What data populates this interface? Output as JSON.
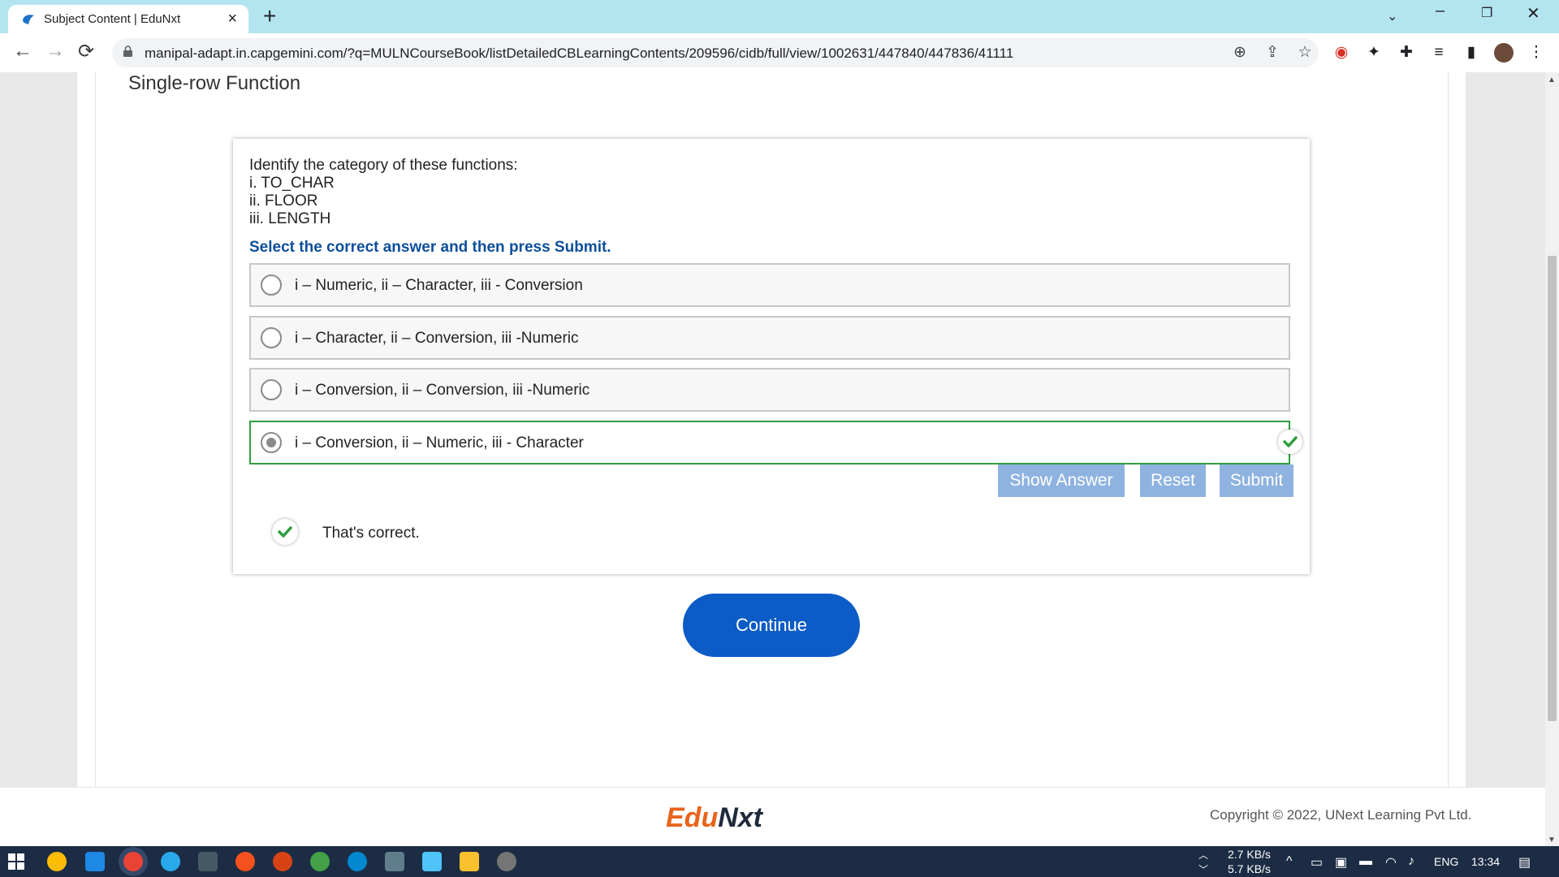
{
  "browser": {
    "tab_title": "Subject Content | EduNxt",
    "url": "manipal-adapt.in.capgemini.com/?q=MULNCourseBook/listDetailedCBLearningContents/209596/cidb/full/view/1002631/447840/447836/41111"
  },
  "page": {
    "heading": "Single-row Function"
  },
  "question": {
    "lines": [
      "Identify the category of these functions:",
      "i. TO_CHAR",
      "ii. FLOOR",
      "iii. LENGTH"
    ],
    "instruction": "Select the correct answer and then press Submit.",
    "options": [
      {
        "label": "i – Numeric, ii – Character, iii - Conversion",
        "selected": false
      },
      {
        "label": "i – Character, ii – Conversion, iii -Numeric",
        "selected": false
      },
      {
        "label": "i – Conversion, ii – Conversion, iii -Numeric",
        "selected": false
      },
      {
        "label": "i – Conversion, ii – Numeric, iii - Character",
        "selected": true,
        "correct": true
      }
    ],
    "buttons": {
      "show_answer": "Show Answer",
      "reset": "Reset",
      "submit": "Submit"
    },
    "feedback": "That's correct.",
    "continue": "Continue"
  },
  "footer": {
    "logo_part1": "Edu",
    "logo_part2": "Nxt",
    "copyright": "Copyright © 2022, UNext Learning Pvt Ltd."
  },
  "taskbar": {
    "net_up": "2.7 KB/s",
    "net_down": "5.7 KB/s",
    "language": "ENG",
    "time": "13:34"
  },
  "colors": {
    "accent": "#0d5bc6",
    "correct": "#2e9e3c",
    "instruction": "#0d4f9c",
    "tab_strip": "#b3e5f0",
    "logo_orange": "#e8641c",
    "logo_dark": "#1f2b3d"
  }
}
